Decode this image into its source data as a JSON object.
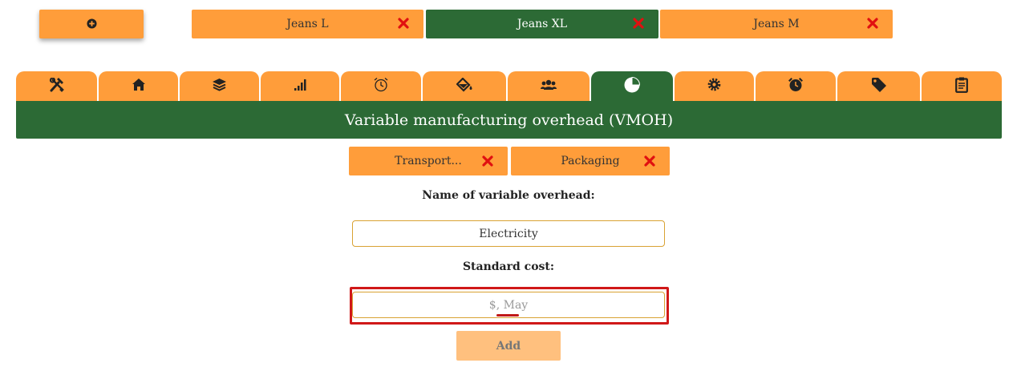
{
  "top_bar": {
    "add_button_icon": "plus-circle-icon",
    "products": [
      {
        "label": "Jeans L",
        "active": false
      },
      {
        "label": "Jeans XL",
        "active": true
      },
      {
        "label": "Jeans M",
        "active": false
      }
    ],
    "close_icon": "close-x-icon"
  },
  "icon_tabs": [
    {
      "icon": "tools-icon"
    },
    {
      "icon": "home-icon"
    },
    {
      "icon": "layers-icon"
    },
    {
      "icon": "signal-bars-icon"
    },
    {
      "icon": "alarm-clock-outline-icon"
    },
    {
      "icon": "paint-bucket-icon"
    },
    {
      "icon": "users-icon"
    },
    {
      "icon": "pie-chart-icon",
      "active": true
    },
    {
      "icon": "gear-icon"
    },
    {
      "icon": "alarm-clock-icon"
    },
    {
      "icon": "tag-icon"
    },
    {
      "icon": "clipboard-icon"
    }
  ],
  "section": {
    "title": "Variable manufacturing overhead (VMOH)"
  },
  "overhead_tabs": [
    {
      "label": "Transport..."
    },
    {
      "label": "Packaging"
    }
  ],
  "form": {
    "name_label": "Name of variable overhead:",
    "name_value": "Electricity",
    "cost_label": "Standard cost:",
    "cost_placeholder": "$, May",
    "add_label": "Add"
  },
  "colors": {
    "orange": "#ff9d3a",
    "green": "#2c6a35",
    "close_red": "#e01010",
    "highlight_red": "#d01818"
  }
}
